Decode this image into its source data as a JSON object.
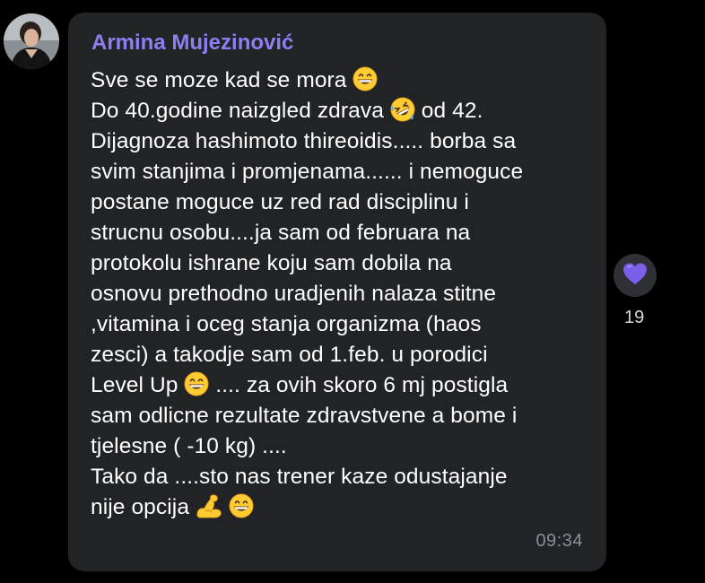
{
  "message": {
    "sender": "Armina Mujezinović",
    "lines": [
      [
        {
          "t": "Sve se moze kad se mora "
        },
        {
          "e": "grin"
        }
      ],
      [
        {
          "t": "Do 40.godine naizgled zdrava "
        },
        {
          "e": "rofl"
        },
        {
          "t": "  od 42."
        }
      ],
      [
        {
          "t": "Dijagnoza hashimoto thireoidis..... borba sa"
        }
      ],
      [
        {
          "t": "svim stanjima i promjenama...... i nemoguce"
        }
      ],
      [
        {
          "t": "postane moguce uz red rad disciplinu i"
        }
      ],
      [
        {
          "t": "strucnu osobu....ja sam od februara na"
        }
      ],
      [
        {
          "t": "protokolu ishrane koju sam dobila na"
        }
      ],
      [
        {
          "t": "osnovu prethodno uradjenih nalaza stitne"
        }
      ],
      [
        {
          "t": ",vitamina i oceg stanja organizma (haos"
        }
      ],
      [
        {
          "t": "zesci) a takodje sam od 1.feb. u porodici"
        }
      ],
      [
        {
          "t": "Level Up "
        },
        {
          "e": "grin"
        },
        {
          "t": "  .... za ovih skoro 6 mj postigla"
        }
      ],
      [
        {
          "t": "sam odlicne rezultate zdravstvene  a bome i"
        }
      ],
      [
        {
          "t": "tjelesne  ( -10 kg) ...."
        }
      ],
      [
        {
          "t": "Tako da ....sto nas trener kaze odustajanje"
        }
      ],
      [
        {
          "t": "nije opcija "
        },
        {
          "e": "muscle"
        },
        {
          "t": " "
        },
        {
          "e": "grin"
        }
      ]
    ],
    "time": "09:34"
  },
  "reaction": {
    "icon": "purple-heart-icon",
    "count": "19"
  },
  "colors": {
    "background": "#000000",
    "bubble": "#212327",
    "sender": "#8b7ff1",
    "text": "#ffffff",
    "time": "#8c8e93",
    "reaction_bg": "#2e3035",
    "heart": "#7b5fe8"
  }
}
